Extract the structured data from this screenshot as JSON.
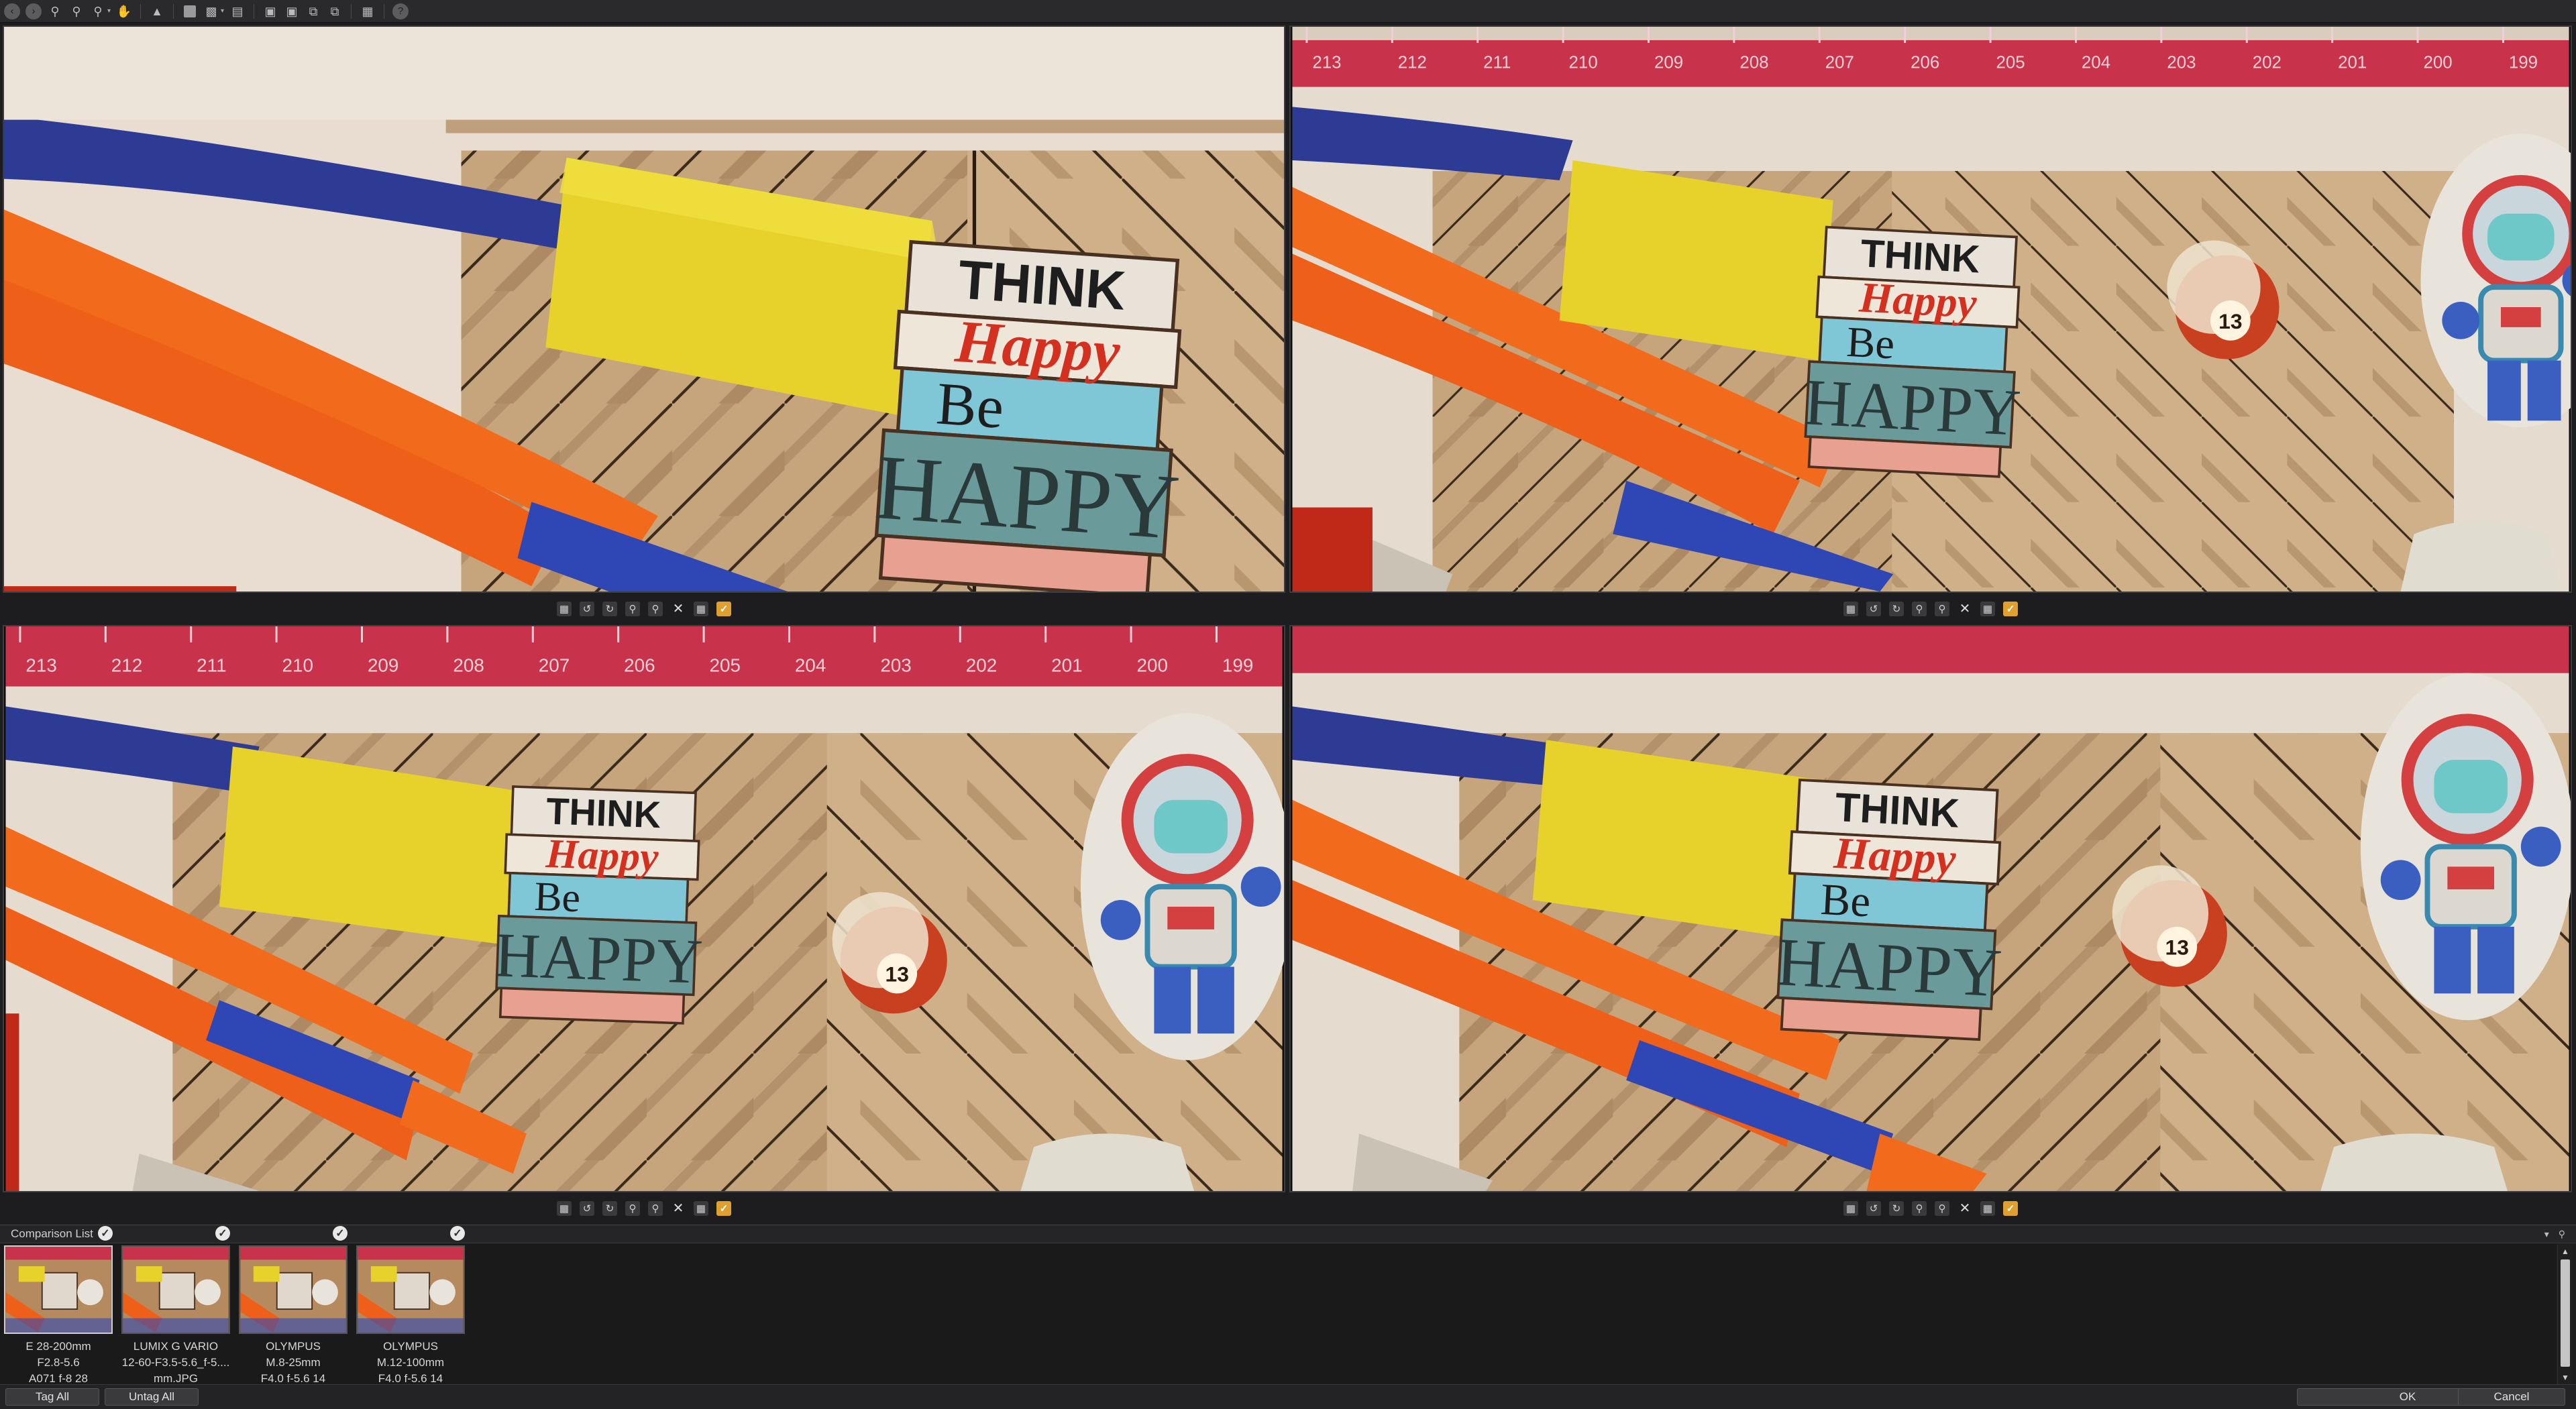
{
  "toolbar": {
    "buttons": [
      "back-icon",
      "forward-icon",
      "zoom-in-icon",
      "zoom-out-icon",
      "zoom-fit-icon",
      "hand-icon",
      "highlight-icon",
      "histogram-icon",
      "layout-icon",
      "window-icon",
      "compare-icon",
      "help-icon"
    ],
    "help_glyph": "?"
  },
  "panes": [
    {
      "id": 1,
      "label": "pane-1"
    },
    {
      "id": 2,
      "label": "pane-2"
    },
    {
      "id": 3,
      "label": "pane-3"
    },
    {
      "id": 4,
      "label": "pane-4"
    }
  ],
  "photo": {
    "sign_line1": "THINK",
    "sign_line2": "Happy",
    "sign_line3": "Be",
    "sign_line4": "HAPPY",
    "ball_number": "13",
    "ruler_numbers": [
      "213",
      "212",
      "211",
      "210",
      "209",
      "208",
      "207",
      "206",
      "205",
      "204",
      "203",
      "202",
      "201",
      "200",
      "199"
    ]
  },
  "comparison_list": {
    "title": "Comparison List",
    "thumbnails": [
      {
        "line1": "E 28-200mm",
        "line2": "F2.8-5.6",
        "line3": "A071 f-8 28",
        "checked": true,
        "selected": true
      },
      {
        "line1": "LUMIX G VARIO",
        "line2": "12-60-F3.5-5.6_f-5....",
        "line3": "mm.JPG",
        "checked": true,
        "selected": false
      },
      {
        "line1": "OLYMPUS",
        "line2": "M.8-25mm",
        "line3": "F4.0 f-5.6 14",
        "checked": true,
        "selected": false
      },
      {
        "line1": "OLYMPUS",
        "line2": "M.12-100mm",
        "line3": "F4.0 f-5.6 14",
        "checked": true,
        "selected": false
      }
    ]
  },
  "footer": {
    "tag_all": "Tag All",
    "untag_all": "Untag All",
    "ok": "OK",
    "cancel": "Cancel"
  },
  "colors": {
    "wood_light": "#c8a882",
    "wood_dark": "#8a6a4a",
    "brush_orange": "#ee5f1a",
    "brush_blue": "#2f3f9a",
    "sponge_yellow": "#e6d22a",
    "ruler_red": "#c8324a",
    "accent_check": "#e0a030"
  }
}
